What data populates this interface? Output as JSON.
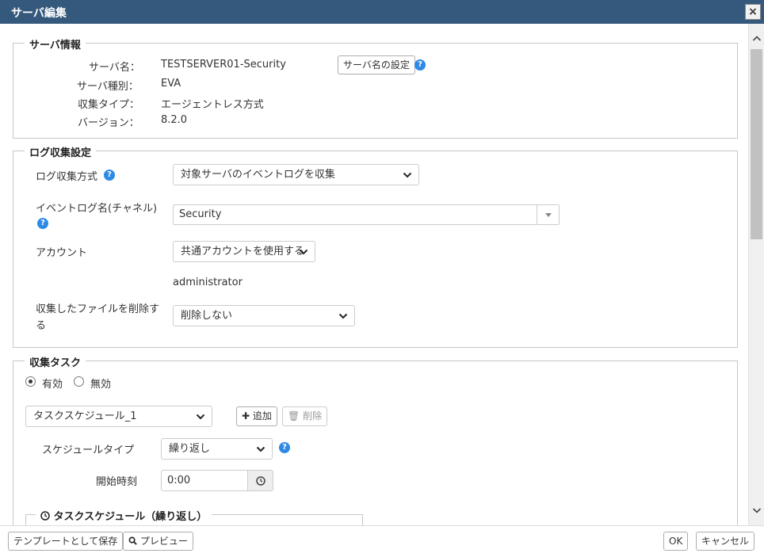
{
  "dialog": {
    "title": "サーバ編集",
    "close": "×"
  },
  "server_info": {
    "legend": "サーバ情報",
    "rows": [
      {
        "label": "サーバ名：",
        "value": "TESTSERVER01-Security"
      },
      {
        "label": "サーバ種別：",
        "value": "EVA"
      },
      {
        "label": "収集タイプ：",
        "value": "エージェントレス方式"
      },
      {
        "label": "バージョン：",
        "value": "8.2.0"
      }
    ],
    "set_name_button": "サーバ名の設定",
    "help": "?"
  },
  "log_settings": {
    "legend": "ログ収集設定",
    "method_label": "ログ収集方式",
    "method_value": "対象サーバのイベントログを収集",
    "eventlog_label": "イベントログ名(チャネル)",
    "eventlog_value": "Security",
    "account_label": "アカウント",
    "account_value": "共通アカウントを使用する",
    "account_user": "administrator",
    "delete_label_line1": "収集したファイルを削除す",
    "delete_label_line2": "る",
    "delete_value": "削除しない",
    "help": "?"
  },
  "task": {
    "legend": "収集タスク",
    "enabled_label": "有効",
    "disabled_label": "無効",
    "enabled": true,
    "schedule_value": "タスクスケジュール_1",
    "add_button": "追加",
    "delete_button": "削除",
    "schedule_type_label": "スケジュールタイプ",
    "schedule_type_value": "繰り返し",
    "start_time_label": "開始時刻",
    "start_time_value": "0:00",
    "sub_legend": "タスクスケジュール（繰り返し）",
    "help": "?"
  },
  "footer": {
    "save_template": "テンプレートとして保存",
    "preview": "プレビュー",
    "ok": "OK",
    "cancel": "キャンセル"
  }
}
